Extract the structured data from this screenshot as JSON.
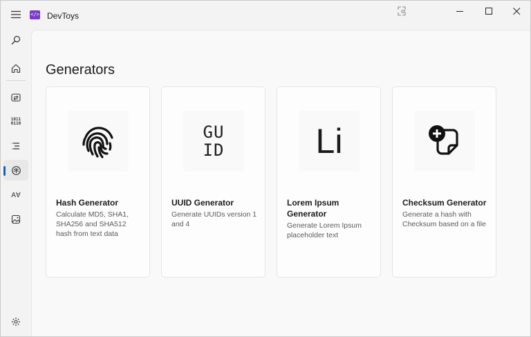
{
  "window": {
    "title": "DevToys"
  },
  "app": {
    "logo_text": "</>"
  },
  "icons": {
    "menu": "hamburger-icon",
    "compact_overlay": "compact-overlay-icon",
    "minimize": "minimize-icon",
    "maximize": "maximize-icon",
    "close": "close-icon",
    "settings": "gear-icon"
  },
  "sidebar": {
    "items": [
      {
        "icon": "search-icon"
      },
      {
        "icon": "home-icon"
      },
      {
        "icon": "converters-icon"
      },
      {
        "icon": "encoders-decoders-icon",
        "glyph_top": "1011",
        "glyph_bottom": "0110"
      },
      {
        "icon": "formatters-icon"
      },
      {
        "icon": "generators-icon",
        "selected": true
      },
      {
        "icon": "text-icon",
        "glyph": "AⱯ"
      },
      {
        "icon": "graphic-icon"
      }
    ],
    "accent_color": "#1a5fb4"
  },
  "main": {
    "title": "Generators",
    "cards": [
      {
        "title": "Hash Generator",
        "description": "Calculate MD5, SHA1, SHA256 and SHA512 hash from text data",
        "icon": "fingerprint-icon"
      },
      {
        "title": "UUID Generator",
        "description": "Generate UUIDs version 1 and 4",
        "icon": "guid-icon",
        "glyph": "GU\nID"
      },
      {
        "title": "Lorem Ipsum Generator",
        "description": "Generate Lorem Ipsum placeholder text",
        "icon": "lorem-ipsum-icon",
        "glyph": "Li"
      },
      {
        "title": "Checksum Generator",
        "description": "Generate a hash with Checksum based on a file",
        "icon": "checksum-icon"
      }
    ]
  }
}
